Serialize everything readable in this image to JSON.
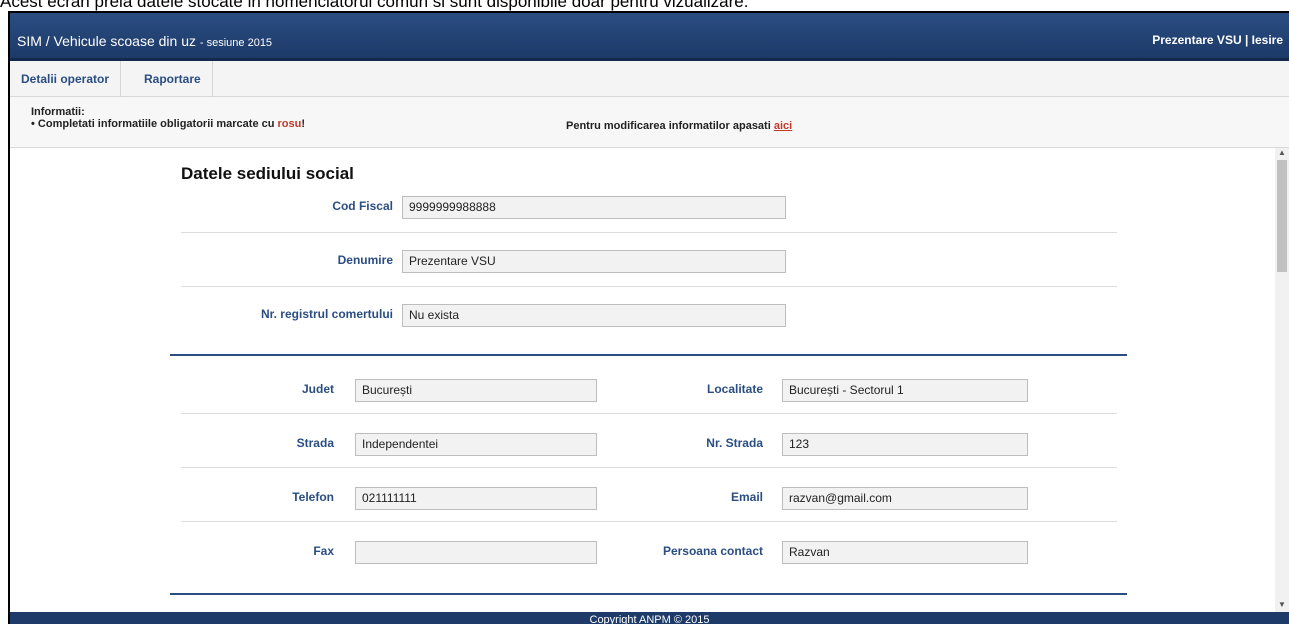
{
  "caption": "Acest ecran preia datele stocate in nomenclatorul comun si sunt disponibile doar pentru vizualizare.",
  "header": {
    "title": "SIM / Vehicule scoase din uz",
    "subtitle": "- sesiune 2015",
    "right_links": "Prezentare VSU | Iesire"
  },
  "nav": {
    "tabs": [
      "Detalii operator",
      "Raportare"
    ]
  },
  "info": {
    "label": "Informatii:",
    "required_prefix": "• Completati informatiile obligatorii marcate cu ",
    "required_red": "rosu",
    "required_suffix": "!",
    "modify_text": "Pentru modificarea informatilor apasati ",
    "modify_link": "aici"
  },
  "form": {
    "section_title": "Datele sediului social",
    "cod_fiscal": {
      "label": "Cod Fiscal",
      "value": "9999999988888"
    },
    "denumire": {
      "label": "Denumire",
      "value": "Prezentare VSU"
    },
    "nr_registru": {
      "label": "Nr. registrul comertului",
      "value": "Nu exista"
    },
    "judet": {
      "label": "Judet",
      "value": "București"
    },
    "localitate": {
      "label": "Localitate",
      "value": "București - Sectorul 1"
    },
    "strada": {
      "label": "Strada",
      "value": "Independentei"
    },
    "nr_strada": {
      "label": "Nr. Strada",
      "value": "123"
    },
    "telefon": {
      "label": "Telefon",
      "value": "021111111"
    },
    "email": {
      "label": "Email",
      "value": "razvan@gmail.com"
    },
    "fax": {
      "label": "Fax",
      "value": ""
    },
    "persoana_contact": {
      "label": "Persoana contact",
      "value": "Razvan"
    }
  },
  "footer": {
    "text": "Copyright ANPM © 2015"
  },
  "colors": {
    "header_bg": "#1d3a68",
    "label": "#2a4d82",
    "required": "#c0392b"
  }
}
